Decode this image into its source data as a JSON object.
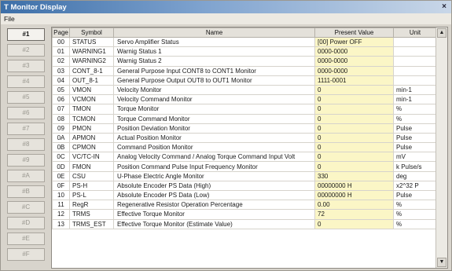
{
  "window": {
    "title": "T Monitor Display",
    "close_glyph": "×"
  },
  "menu": {
    "file": "File"
  },
  "sidebar": {
    "buttons": [
      "#1",
      "#2",
      "#3",
      "#4",
      "#5",
      "#6",
      "#7",
      "#8",
      "#9",
      "#A",
      "#B",
      "#C",
      "#D",
      "#E",
      "#F"
    ],
    "active_index": 0
  },
  "table": {
    "headers": {
      "page": "Page",
      "symbol": "Symbol",
      "name": "Name",
      "value": "Present Value",
      "unit": "Unit"
    },
    "rows": [
      {
        "page": "00",
        "symbol": "STATUS",
        "name": "Servo Amplifier Status",
        "value": "[00] Power OFF",
        "unit": ""
      },
      {
        "page": "01",
        "symbol": "WARNING1",
        "name": "Warnig Status 1",
        "value": "0000-0000",
        "unit": ""
      },
      {
        "page": "02",
        "symbol": "WARNING2",
        "name": "Warnig Status 2",
        "value": "0000-0000",
        "unit": ""
      },
      {
        "page": "03",
        "symbol": "CONT_8-1",
        "name": "General Purpose Input CONT8 to CONT1 Monitor",
        "value": "0000-0000",
        "unit": ""
      },
      {
        "page": "04",
        "symbol": "OUT_8-1",
        "name": "General Purpose Output OUT8 to OUT1 Monitor",
        "value": "1111-0001",
        "unit": ""
      },
      {
        "page": "05",
        "symbol": "VMON",
        "name": "Velocity Monitor",
        "value": "0",
        "unit": "min-1"
      },
      {
        "page": "06",
        "symbol": "VCMON",
        "name": "Velocity Command Monitor",
        "value": "0",
        "unit": "min-1"
      },
      {
        "page": "07",
        "symbol": "TMON",
        "name": "Torque Monitor",
        "value": "0",
        "unit": "%"
      },
      {
        "page": "08",
        "symbol": "TCMON",
        "name": "Torque Command Monitor",
        "value": "0",
        "unit": "%"
      },
      {
        "page": "09",
        "symbol": "PMON",
        "name": "Position Deviation Monitor",
        "value": "0",
        "unit": "Pulse"
      },
      {
        "page": "0A",
        "symbol": "APMON",
        "name": "Actual Position Monitor",
        "value": "0",
        "unit": "Pulse"
      },
      {
        "page": "0B",
        "symbol": "CPMON",
        "name": "Command Position Monitor",
        "value": "0",
        "unit": "Pulse"
      },
      {
        "page": "0C",
        "symbol": "VC/TC-IN",
        "name": "Analog Velocity Command / Analog Torque Command Input Volt",
        "value": "0",
        "unit": "mV"
      },
      {
        "page": "0D",
        "symbol": "FMON",
        "name": "Position Command Pulse Input Frequency Monitor",
        "value": "0",
        "unit": "k Pulse/s"
      },
      {
        "page": "0E",
        "symbol": "CSU",
        "name": "U-Phase Electric Angle Monitor",
        "value": "330",
        "unit": "deg"
      },
      {
        "page": "0F",
        "symbol": "PS-H",
        "name": "Absolute Encoder PS Data (High)",
        "value": "00000000 H",
        "unit": "x2^32 P"
      },
      {
        "page": "10",
        "symbol": "PS-L",
        "name": "Absolute Encoder PS Data (Low)",
        "value": "00000000 H",
        "unit": "Pulse"
      },
      {
        "page": "11",
        "symbol": "RegR",
        "name": "Regenerative Resistor Operation Percentage",
        "value": "0.00",
        "unit": "%"
      },
      {
        "page": "12",
        "symbol": "TRMS",
        "name": "Effective Torque Monitor",
        "value": "72",
        "unit": "%"
      },
      {
        "page": "13",
        "symbol": "TRMS_EST",
        "name": "Effective Torque Monitor (Estimate Value)",
        "value": "0",
        "unit": "%"
      }
    ]
  },
  "scrollbar": {
    "up_glyph": "▲",
    "down_glyph": "▼"
  }
}
